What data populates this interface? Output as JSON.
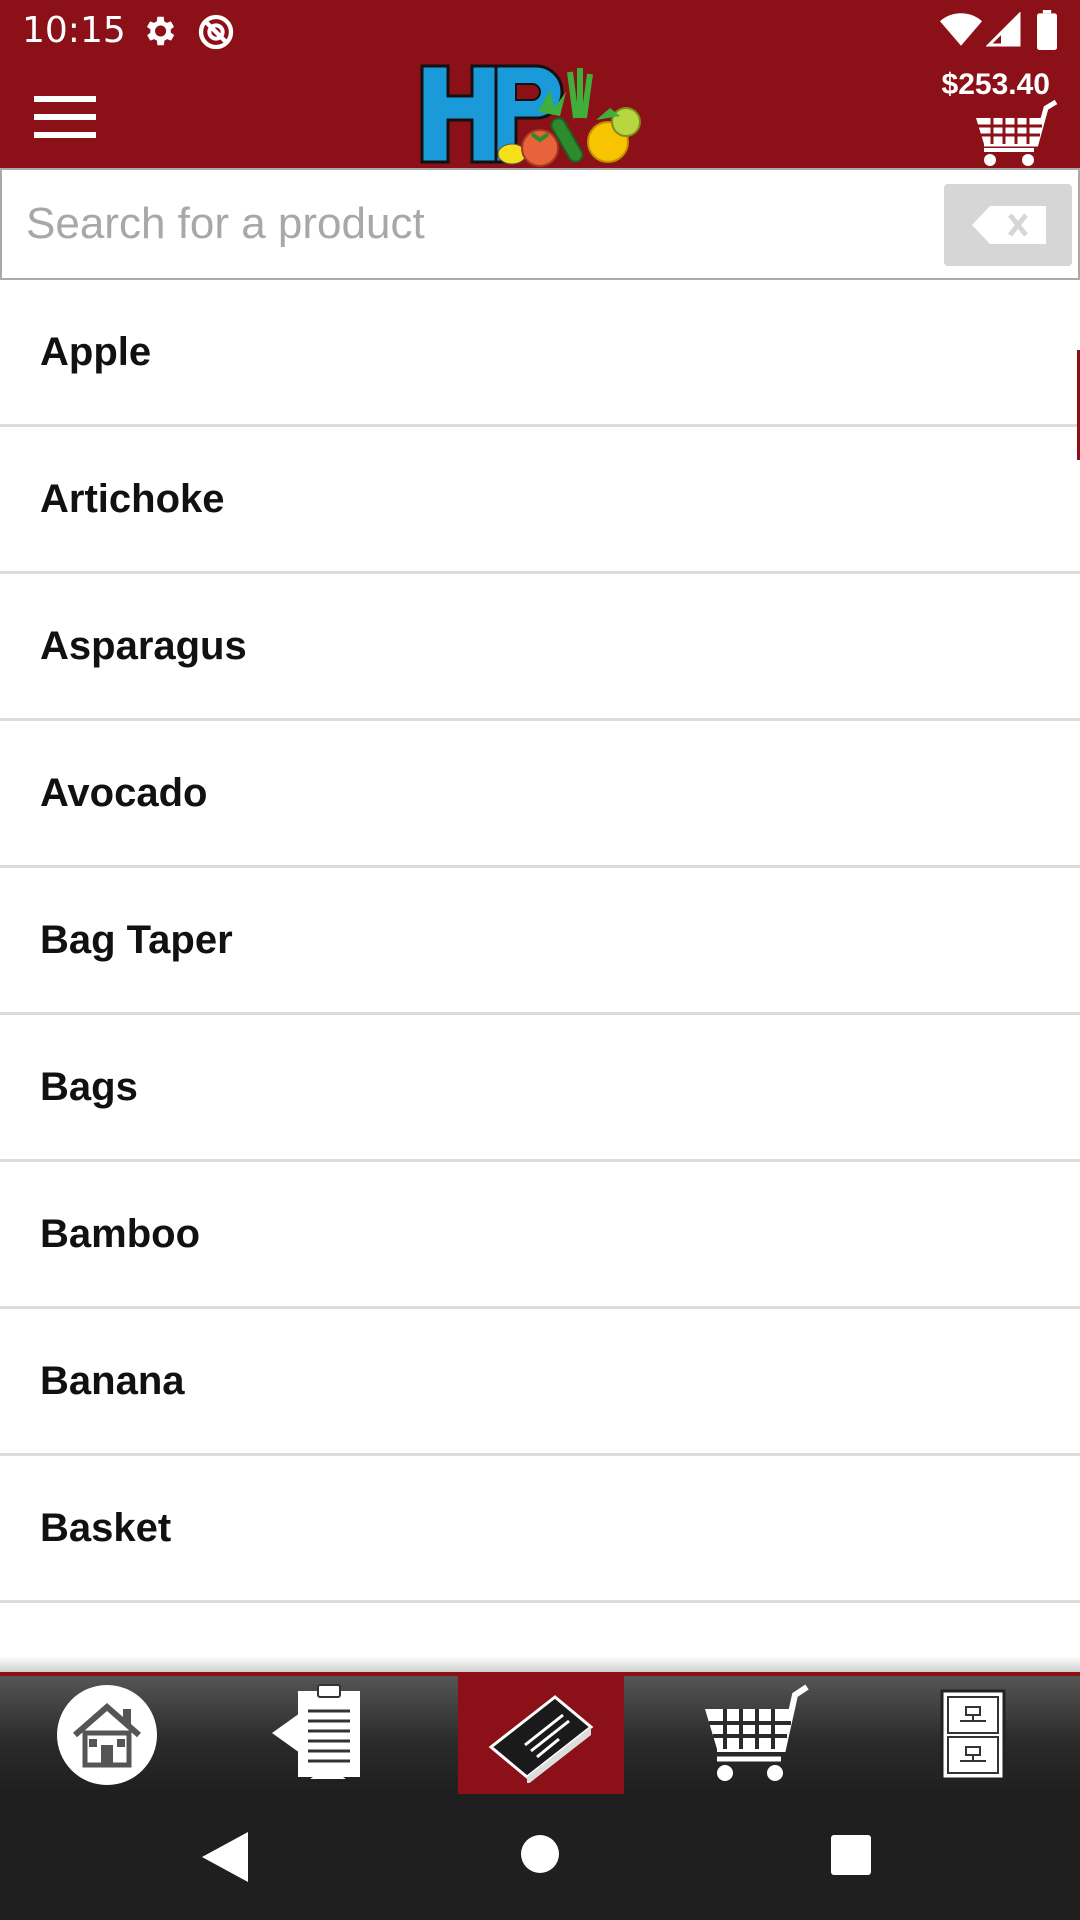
{
  "status_bar": {
    "time": "10:15",
    "icons": [
      "gear-icon",
      "do-not-disturb-icon",
      "wifi-icon",
      "signal-icon",
      "battery-icon"
    ]
  },
  "header": {
    "menu_icon": "hamburger-menu-icon",
    "logo": "hp-produce-logo",
    "cart_total": "$253.40",
    "cart_icon": "shopping-cart-icon"
  },
  "search": {
    "placeholder": "Search for a product",
    "value": "",
    "clear_icon": "backspace-clear-icon"
  },
  "products": [
    {
      "label": "Apple"
    },
    {
      "label": "Artichoke"
    },
    {
      "label": "Asparagus"
    },
    {
      "label": "Avocado"
    },
    {
      "label": "Bag Taper"
    },
    {
      "label": "Bags"
    },
    {
      "label": "Bamboo"
    },
    {
      "label": "Banana"
    },
    {
      "label": "Basket"
    }
  ],
  "bottom_nav": {
    "items": [
      {
        "icon": "home-icon",
        "active": false
      },
      {
        "icon": "order-history-icon",
        "active": false
      },
      {
        "icon": "catalog-book-icon",
        "active": true
      },
      {
        "icon": "cart-icon",
        "active": false
      },
      {
        "icon": "file-cabinet-icon",
        "active": false
      }
    ]
  },
  "colors": {
    "brand": "#8b1017",
    "nav_background": "#2b2b2b",
    "divider": "#dcdcdc"
  }
}
